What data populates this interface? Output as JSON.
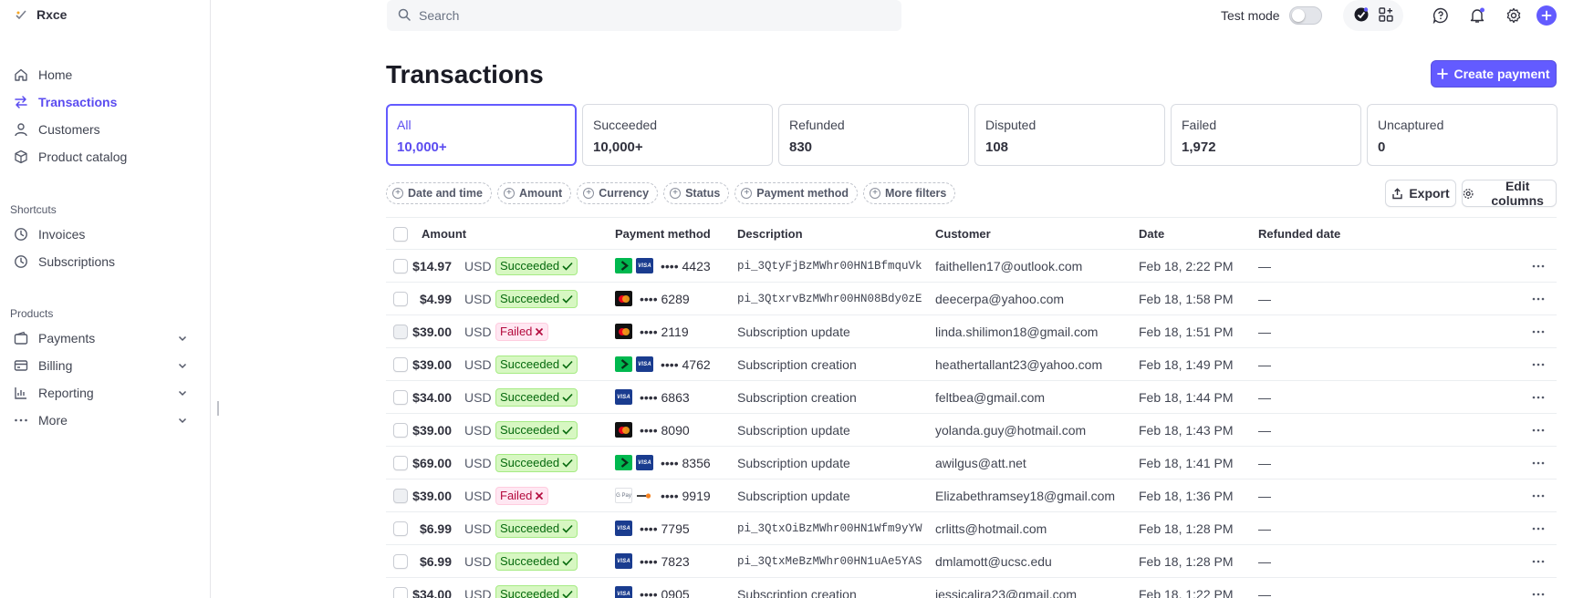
{
  "brand": {
    "name": "Rxce"
  },
  "sidebar": {
    "main": [
      {
        "label": "Home",
        "icon": "home-icon",
        "active": false
      },
      {
        "label": "Transactions",
        "icon": "transactions-icon",
        "active": true
      },
      {
        "label": "Customers",
        "icon": "customers-icon",
        "active": false
      },
      {
        "label": "Product catalog",
        "icon": "product-catalog-icon",
        "active": false
      }
    ],
    "shortcuts_title": "Shortcuts",
    "shortcuts": [
      {
        "label": "Invoices",
        "icon": "clock-icon"
      },
      {
        "label": "Subscriptions",
        "icon": "clock-icon"
      }
    ],
    "products_title": "Products",
    "products": [
      {
        "label": "Payments",
        "icon": "payments-icon"
      },
      {
        "label": "Billing",
        "icon": "billing-icon"
      },
      {
        "label": "Reporting",
        "icon": "reporting-icon"
      },
      {
        "label": "More",
        "icon": "more-icon"
      }
    ]
  },
  "topbar": {
    "search_placeholder": "Search",
    "test_mode_label": "Test mode",
    "test_mode_on": false
  },
  "header": {
    "title": "Transactions",
    "create_label": "Create payment"
  },
  "cards": [
    {
      "label": "All",
      "count": "10,000+",
      "active": true
    },
    {
      "label": "Succeeded",
      "count": "10,000+",
      "active": false
    },
    {
      "label": "Refunded",
      "count": "830",
      "active": false
    },
    {
      "label": "Disputed",
      "count": "108",
      "active": false
    },
    {
      "label": "Failed",
      "count": "1,972",
      "active": false
    },
    {
      "label": "Uncaptured",
      "count": "0",
      "active": false
    }
  ],
  "filters": [
    "Date and time",
    "Amount",
    "Currency",
    "Status",
    "Payment method",
    "More filters"
  ],
  "tools": {
    "export": "Export",
    "edit_columns": "Edit columns"
  },
  "table": {
    "columns": {
      "amount": "Amount",
      "payment_method": "Payment method",
      "description": "Description",
      "customer": "Customer",
      "date": "Date",
      "refunded_date": "Refunded date"
    },
    "rows": [
      {
        "amount": "$14.97",
        "currency": "USD",
        "status": "Succeeded",
        "methods": [
          "link",
          "visa"
        ],
        "last4": "•••• 4423",
        "description": "pi_3QtyFjBzMWhr00HN1BfmquVk",
        "desc_mono": true,
        "customer": "faithellen17@outlook.com",
        "date": "Feb 18, 2:22 PM",
        "refunded": "—"
      },
      {
        "amount": "$4.99",
        "currency": "USD",
        "status": "Succeeded",
        "methods": [
          "mastercard"
        ],
        "last4": "•••• 6289",
        "description": "pi_3QtxrvBzMWhr00HN08Bdy0zE",
        "desc_mono": true,
        "customer": "deecerpa@yahoo.com",
        "date": "Feb 18, 1:58 PM",
        "refunded": "—"
      },
      {
        "amount": "$39.00",
        "currency": "USD",
        "status": "Failed",
        "methods": [
          "mastercard"
        ],
        "last4": "•••• 2119",
        "description": "Subscription update",
        "desc_mono": false,
        "customer": "linda.shilimon18@gmail.com",
        "date": "Feb 18, 1:51 PM",
        "refunded": "—"
      },
      {
        "amount": "$39.00",
        "currency": "USD",
        "status": "Succeeded",
        "methods": [
          "link",
          "visa"
        ],
        "last4": "•••• 4762",
        "description": "Subscription creation",
        "desc_mono": false,
        "customer": "heathertallant23@yahoo.com",
        "date": "Feb 18, 1:49 PM",
        "refunded": "—"
      },
      {
        "amount": "$34.00",
        "currency": "USD",
        "status": "Succeeded",
        "methods": [
          "visa"
        ],
        "last4": "•••• 6863",
        "description": "Subscription creation",
        "desc_mono": false,
        "customer": "feltbea@gmail.com",
        "date": "Feb 18, 1:44 PM",
        "refunded": "—"
      },
      {
        "amount": "$39.00",
        "currency": "USD",
        "status": "Succeeded",
        "methods": [
          "mastercard"
        ],
        "last4": "•••• 8090",
        "description": "Subscription update",
        "desc_mono": false,
        "customer": "yolanda.guy@hotmail.com",
        "date": "Feb 18, 1:43 PM",
        "refunded": "—"
      },
      {
        "amount": "$69.00",
        "currency": "USD",
        "status": "Succeeded",
        "methods": [
          "link",
          "visa"
        ],
        "last4": "•••• 8356",
        "description": "Subscription update",
        "desc_mono": false,
        "customer": "awilgus@att.net",
        "date": "Feb 18, 1:41 PM",
        "refunded": "—"
      },
      {
        "amount": "$39.00",
        "currency": "USD",
        "status": "Failed",
        "methods": [
          "gpay",
          "discover"
        ],
        "last4": "•••• 9919",
        "description": "Subscription update",
        "desc_mono": false,
        "customer": "Elizabethramsey18@gmail.com",
        "date": "Feb 18, 1:36 PM",
        "refunded": "—"
      },
      {
        "amount": "$6.99",
        "currency": "USD",
        "status": "Succeeded",
        "methods": [
          "visa"
        ],
        "last4": "•••• 7795",
        "description": "pi_3QtxOiBzMWhr00HN1Wfm9yYW",
        "desc_mono": true,
        "customer": "crlitts@hotmail.com",
        "date": "Feb 18, 1:28 PM",
        "refunded": "—"
      },
      {
        "amount": "$6.99",
        "currency": "USD",
        "status": "Succeeded",
        "methods": [
          "visa"
        ],
        "last4": "•••• 7823",
        "description": "pi_3QtxMeBzMWhr00HN1uAe5YAS",
        "desc_mono": true,
        "customer": "dmlamott@ucsc.edu",
        "date": "Feb 18, 1:28 PM",
        "refunded": "—"
      },
      {
        "amount": "$34.00",
        "currency": "USD",
        "status": "Succeeded",
        "methods": [
          "visa"
        ],
        "last4": "•••• 0905",
        "description": "Subscription creation",
        "desc_mono": false,
        "customer": "jessicalira23@gmail.com",
        "date": "Feb 18, 1:22 PM",
        "refunded": "—"
      }
    ]
  },
  "colors": {
    "accent": "#635bff",
    "success_bg": "#d7f7c2",
    "success_fg": "#05690d",
    "fail_bg": "#ffe7f2",
    "fail_fg": "#b3093c"
  }
}
